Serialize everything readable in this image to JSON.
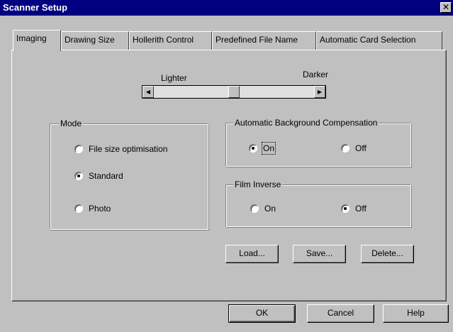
{
  "window": {
    "title": "Scanner Setup",
    "close_glyph": "✕"
  },
  "tabs": [
    {
      "label": "Imaging",
      "active": true
    },
    {
      "label": "Drawing Size",
      "active": false
    },
    {
      "label": "Hollerith Control",
      "active": false
    },
    {
      "label": "Predefined File Name",
      "active": false
    },
    {
      "label": "Automatic Card Selection",
      "active": false
    }
  ],
  "brightness": {
    "left_label": "Lighter",
    "right_label": "Darker",
    "left_arrow": "◀",
    "right_arrow": "▶",
    "position": 0.5
  },
  "mode": {
    "title": "Mode",
    "options": [
      {
        "label": "File size optimisation",
        "checked": false
      },
      {
        "label": "Standard",
        "checked": true
      },
      {
        "label": "Photo",
        "checked": false
      }
    ]
  },
  "auto_bg": {
    "title": "Automatic Background Compensation",
    "on_label": "On",
    "off_label": "Off",
    "value": "On"
  },
  "film_inverse": {
    "title": "Film Inverse",
    "on_label": "On",
    "off_label": "Off",
    "value": "Off"
  },
  "actions": {
    "load": "Load...",
    "save": "Save...",
    "delete": "Delete..."
  },
  "footer": {
    "ok": "OK",
    "cancel": "Cancel",
    "help": "Help"
  },
  "colors": {
    "titlebar": "#000080",
    "face": "#c0c0c0"
  }
}
